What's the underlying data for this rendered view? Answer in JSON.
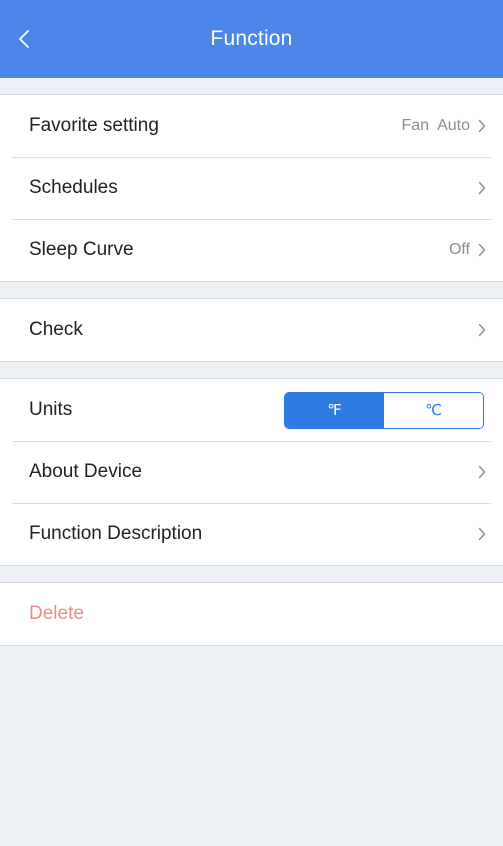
{
  "header": {
    "title": "Function",
    "back_icon": "chevron-left-icon",
    "background_color": "#4b86e8"
  },
  "group1": {
    "favorite": {
      "label": "Favorite setting",
      "value": "Fan  Auto"
    },
    "schedules": {
      "label": "Schedules"
    },
    "sleep_curve": {
      "label": "Sleep Curve",
      "value": "Off"
    }
  },
  "group2": {
    "check": {
      "label": "Check"
    }
  },
  "group3": {
    "units": {
      "label": "Units",
      "fahrenheit": "℉",
      "celsius": "℃",
      "selected": "fahrenheit",
      "accent_color": "#2d7be3"
    },
    "about": {
      "label": "About Device"
    },
    "function_description": {
      "label": "Function Description"
    }
  },
  "group4": {
    "delete": {
      "label": "Delete",
      "color": "#f08a8a"
    }
  }
}
